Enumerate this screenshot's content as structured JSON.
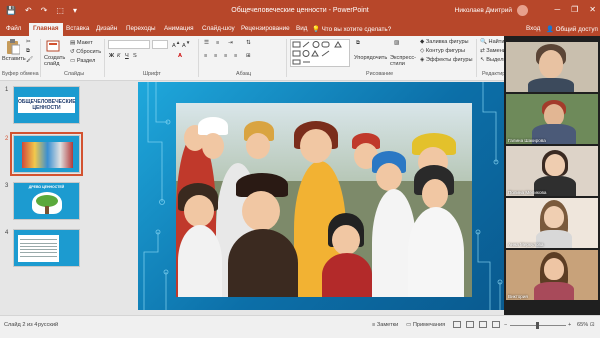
{
  "window": {
    "title": "Общечеловеческие ценности - PowerPoint",
    "account": "Николаев Дмитрий",
    "controls": [
      "─",
      "❐",
      "✕"
    ]
  },
  "qat": [
    "💾",
    "↶",
    "↷",
    "⬚",
    "▾"
  ],
  "tabs": [
    "Файл",
    "Главная",
    "Вставка",
    "Дизайн",
    "Переходы",
    "Анимация",
    "Слайд-шоу",
    "Рецензирование",
    "Вид",
    "Что вы хотите сделать?"
  ],
  "active_tab": "Главная",
  "tab_right": {
    "signin": "Вход",
    "share": "Общий доступ"
  },
  "ribbon": {
    "clipboard": {
      "paste": "Вставить",
      "group": "Буфер обмена"
    },
    "slides": {
      "new_slide": "Создать слайд",
      "layout": "Макет",
      "reset": "Сбросить",
      "section": "Раздел",
      "group": "Слайды"
    },
    "font": {
      "group": "Шрифт",
      "bold": "Ж",
      "italic": "К",
      "underline": "Ч",
      "strike": "S"
    },
    "paragraph": {
      "group": "Абзац"
    },
    "drawing": {
      "arrange": "Упорядочить",
      "quick_styles": "Экспресс-стили",
      "fill": "Заливка фигуры",
      "outline": "Контур фигуры",
      "effects": "Эффекты фигуры",
      "group": "Рисование"
    },
    "editing": {
      "find": "Найти",
      "replace": "Заменить",
      "select": "Выделить",
      "group": "Редактирование"
    }
  },
  "slides_panel": [
    {
      "num": "1",
      "title": "ОБЩЕЧЕЛОВЕЧЕСКИЕ ЦЕННОСТИ"
    },
    {
      "num": "2",
      "title": ""
    },
    {
      "num": "3",
      "title": "ДРЕВО ЦЕННОСТЕЙ"
    },
    {
      "num": "4",
      "title": ""
    }
  ],
  "selected_slide": 2,
  "participants": [
    {
      "name": ""
    },
    {
      "name": "Галина Шакирова"
    },
    {
      "name": "Полина Меликова"
    },
    {
      "name": "Анна Меркулова"
    },
    {
      "name": "Виктория"
    }
  ],
  "status": {
    "slide_info": "Слайд 2 из 4",
    "language": "русский",
    "notes": "Заметки",
    "comments": "Примечания",
    "zoom": "65%"
  },
  "colors": {
    "accent": "#b7472a",
    "slide_blue": "#1fa8dc",
    "selection": "#d35230"
  }
}
